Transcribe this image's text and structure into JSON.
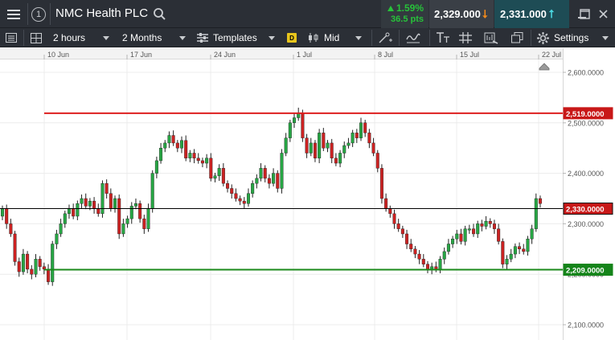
{
  "window": {
    "menu_icon": "hamburger-icon",
    "link_number": "1",
    "title": "NMC Health PLC",
    "search_icon": "search-icon",
    "change_percent": "1.59%",
    "change_points": "36.5 pts",
    "sell_price": "2,329.000",
    "buy_price": "2,331.000",
    "controls": [
      "minimize-icon",
      "maximize-icon",
      "close-icon"
    ]
  },
  "toolbar": {
    "interval": "2 hours",
    "period": "2 Months",
    "templates": "Templates",
    "price_type_badge": "D",
    "price_type": "Mid",
    "settings": "Settings"
  },
  "colors": {
    "up": "#27a644",
    "down": "#cc2222",
    "resistance": "#dd1f1f",
    "support": "#1a8a1a",
    "current": "#000000",
    "change_positive": "#27c23a",
    "sell_arrow": "#f28a1b",
    "buy_arrow": "#4ad6e0"
  },
  "chart_data": {
    "type": "candlestick",
    "x_tick_labels": [
      "10 Jun",
      "17 Jun",
      "24 Jun",
      "1 Jul",
      "8 Jul",
      "15 Jul",
      "22 Jul"
    ],
    "y_tick_labels": [
      "2,600.0000",
      "2,500.0000",
      "2,400.0000",
      "2,300.0000",
      "2,200.0000",
      "2,100.0000"
    ],
    "y_ticks": [
      2600,
      2500,
      2400,
      2300,
      2200,
      2100
    ],
    "ylim": [
      2055,
      2635
    ],
    "grid": true,
    "horizontal_lines": [
      {
        "label": "2,519.0000",
        "value": 2519,
        "role": "resistance"
      },
      {
        "label": "2,330.0000",
        "value": 2330,
        "role": "current"
      },
      {
        "label": "2,209.0000",
        "value": 2209,
        "role": "support"
      }
    ],
    "closes": [
      2330,
      2300,
      2280,
      2225,
      2205,
      2240,
      2210,
      2200,
      2230,
      2215,
      2210,
      2185,
      2260,
      2280,
      2300,
      2320,
      2330,
      2315,
      2340,
      2350,
      2335,
      2345,
      2330,
      2320,
      2380,
      2360,
      2330,
      2350,
      2280,
      2300,
      2310,
      2335,
      2340,
      2310,
      2290,
      2330,
      2400,
      2425,
      2450,
      2460,
      2475,
      2460,
      2450,
      2465,
      2430,
      2440,
      2430,
      2425,
      2420,
      2430,
      2390,
      2395,
      2410,
      2380,
      2370,
      2360,
      2350,
      2345,
      2340,
      2360,
      2380,
      2390,
      2410,
      2390,
      2380,
      2400,
      2370,
      2440,
      2470,
      2500,
      2510,
      2520,
      2470,
      2440,
      2460,
      2430,
      2480,
      2450,
      2460,
      2430,
      2420,
      2440,
      2455,
      2460,
      2480,
      2470,
      2500,
      2480,
      2460,
      2440,
      2410,
      2350,
      2330,
      2320,
      2300,
      2290,
      2280,
      2260,
      2250,
      2240,
      2230,
      2220,
      2210,
      2215,
      2210,
      2230,
      2245,
      2260,
      2270,
      2280,
      2265,
      2290,
      2290,
      2280,
      2300,
      2295,
      2305,
      2300,
      2290,
      2265,
      2220,
      2230,
      2240,
      2255,
      2250,
      2245,
      2270,
      2290,
      2350,
      2340
    ],
    "x_range": {
      "first_label": "10 Jun",
      "last_label": "22 Jul"
    }
  }
}
